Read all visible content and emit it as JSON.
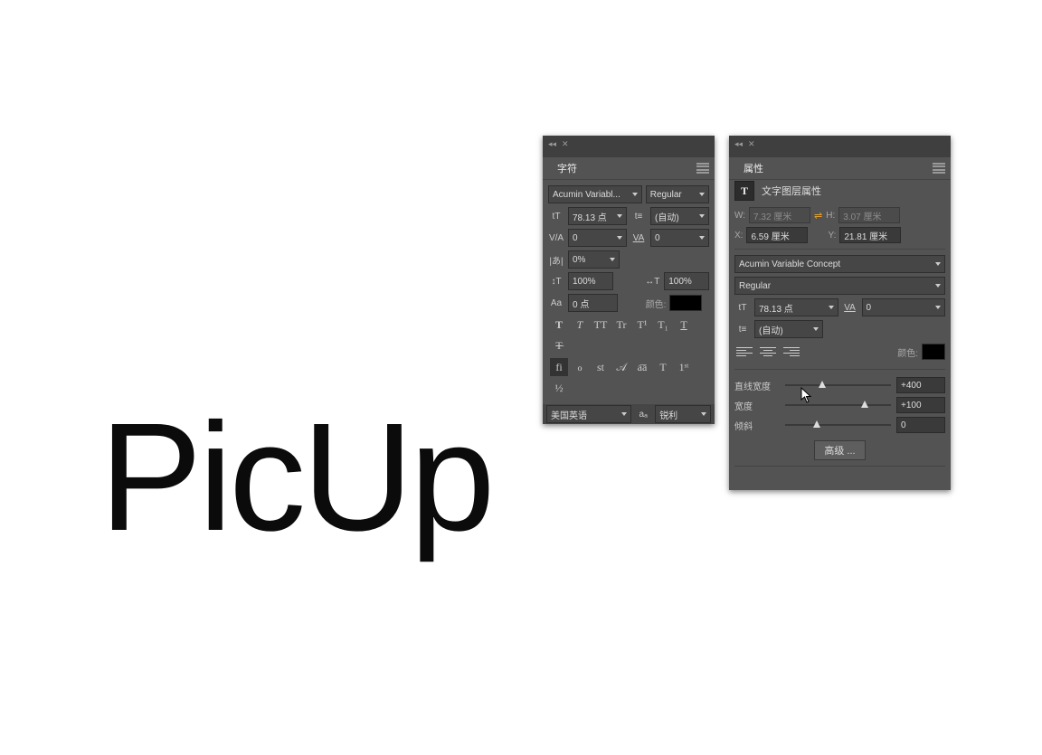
{
  "canvas": {
    "text": "PicUp"
  },
  "char_panel": {
    "title": "字符",
    "font_family": "Acumin Variabl...",
    "font_style": "Regular",
    "font_size": "78.13 点",
    "leading": "(自动)",
    "va_kerning": "0",
    "va_tracking": "0",
    "scale": "0%",
    "vert_scale": "100%",
    "horiz_scale": "100%",
    "baseline_shift": "0 点",
    "color_label": "颜色:",
    "color": "#000000",
    "style_buttons": [
      "T",
      "T",
      "TT",
      "Tr",
      "T¹",
      "T₁",
      "T",
      "T̵"
    ],
    "opentype_buttons": [
      "fi",
      "ℴ",
      "st",
      "𝒜",
      "a͞a",
      "T",
      "1ˢᵗ",
      "½"
    ],
    "language": "美国英语",
    "aa_icon": "aₐ",
    "antialiasing": "锐利"
  },
  "prop_panel": {
    "title": "属性",
    "header_label": "文字图层属性",
    "W_label": "W:",
    "W_val": "7.32 厘米",
    "H_label": "H:",
    "H_val": "3.07 厘米",
    "X_label": "X:",
    "X_val": "6.59 厘米",
    "Y_label": "Y:",
    "Y_val": "21.81 厘米",
    "font_family": "Acumin Variable Concept",
    "font_style": "Regular",
    "font_size": "78.13 点",
    "tracking": "0",
    "leading": "(自动)",
    "color_label": "颜色:",
    "color": "#000000",
    "sliders": {
      "line_width": {
        "label": "直线宽度",
        "value": "+400",
        "pos": 35
      },
      "width": {
        "label": "宽度",
        "value": "+100",
        "pos": 75
      },
      "slant": {
        "label": "倾斜",
        "value": "0",
        "pos": 30
      }
    },
    "advanced": "高级 ..."
  },
  "icons": {
    "fontsize": "tT",
    "leading": "t≡",
    "kerning": "V/A",
    "tracking": "VA",
    "scale": "|あ|",
    "vscale": "↕T",
    "hscale": "↔T",
    "baseline": "Aa"
  }
}
